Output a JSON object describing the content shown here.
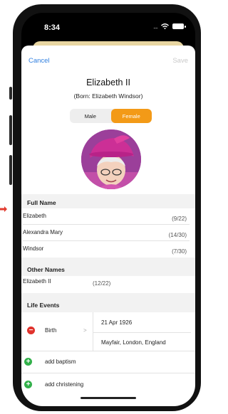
{
  "status_bar": {
    "time": "8:34",
    "signal": "....",
    "wifi_icon": "wifi-icon",
    "battery_icon": "battery-icon"
  },
  "nav": {
    "cancel": "Cancel",
    "save": "Save"
  },
  "person": {
    "name": "Elizabeth II",
    "born": "(Born: Elizabeth Windsor)"
  },
  "gender": {
    "options": [
      "Male",
      "Female"
    ],
    "selected": "Female"
  },
  "full_name": {
    "header": "Full Name",
    "rows": [
      {
        "value": "Elizabeth",
        "count": "(9/22)"
      },
      {
        "value": "Alexandra Mary",
        "count": "(14/30)"
      },
      {
        "value": "Windsor",
        "count": "(7/30)"
      }
    ]
  },
  "other_names": {
    "header": "Other Names",
    "value": "Elizabeth II",
    "count": "(12/22)"
  },
  "life_events": {
    "header": "Life Events",
    "birth": {
      "label": "Birth",
      "chevron": ">",
      "date": "21 Apr 1926",
      "place": "Mayfair, London, England"
    },
    "add_baptism": "add baptism",
    "add_christening": "add christening"
  },
  "colors": {
    "accent": "#2f7fe0",
    "selected_segment": "#f39a17",
    "remove": "#e0322c",
    "add": "#32b04a",
    "section_bg": "#f2f2f2"
  }
}
